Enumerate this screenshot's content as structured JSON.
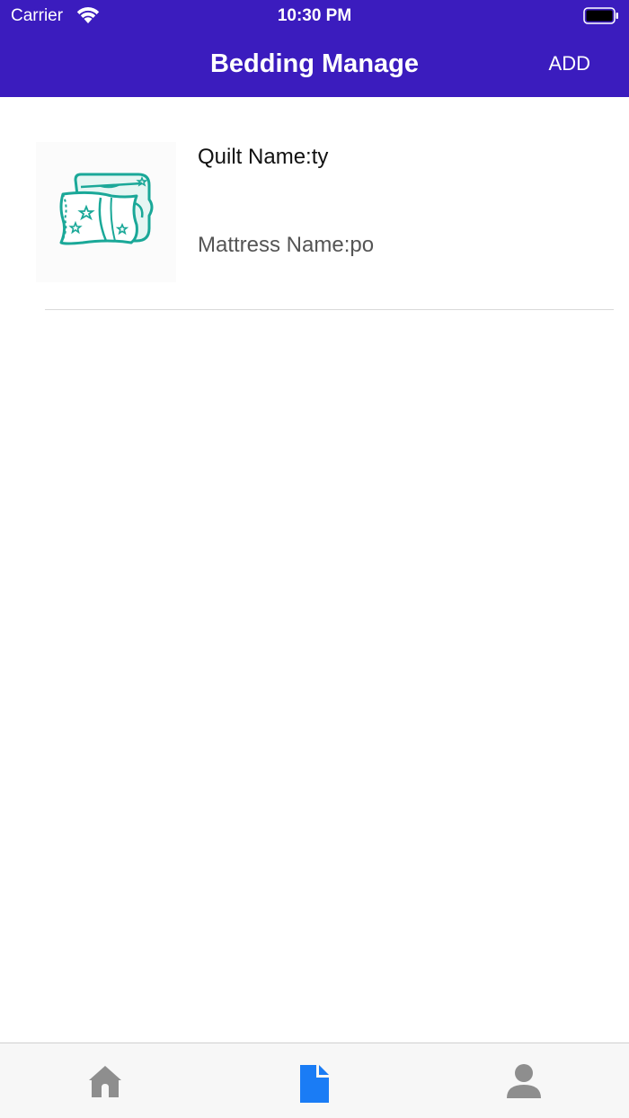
{
  "status_bar": {
    "carrier": "Carrier",
    "time": "10:30 PM"
  },
  "nav": {
    "title": "Bedding Manage",
    "add_label": "ADD",
    "background_color": "#3b1cbe"
  },
  "list": {
    "items": [
      {
        "icon": "bedding-icon",
        "quilt_name": "Quilt Name:ty",
        "mattress_name": "Mattress Name:po"
      }
    ]
  },
  "tabbar": {
    "tabs": [
      {
        "icon": "home-icon",
        "active": false
      },
      {
        "icon": "document-icon",
        "active": true
      },
      {
        "icon": "person-icon",
        "active": false
      }
    ],
    "active_color": "#1a7cf5",
    "inactive_color": "#8e8e8e"
  }
}
